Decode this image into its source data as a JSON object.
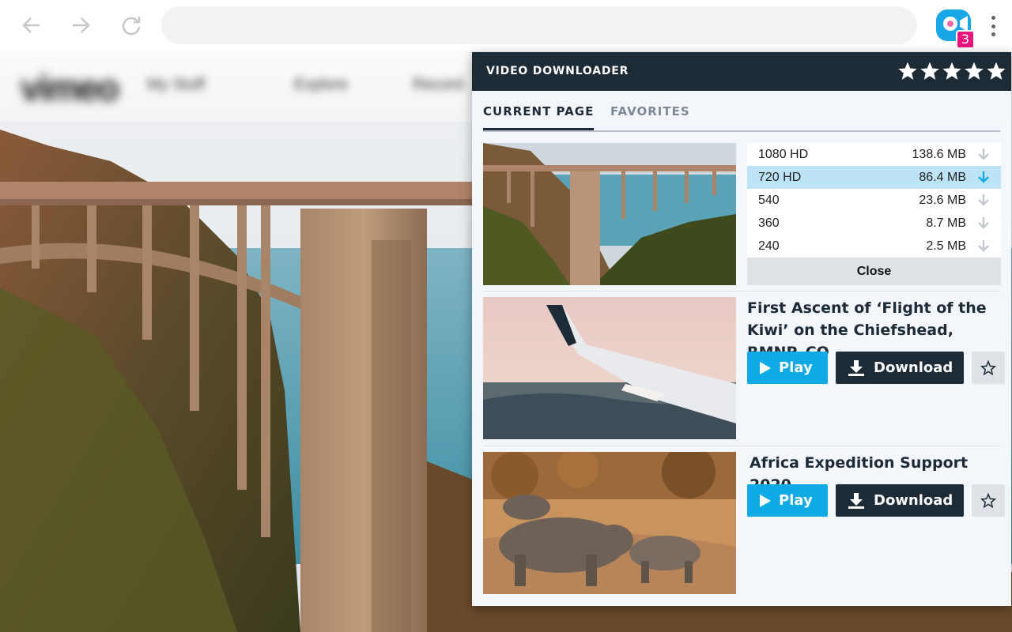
{
  "browser": {
    "back_icon": "arrow-left-icon",
    "forward_icon": "arrow-right-icon",
    "reload_icon": "reload-icon",
    "extension_badge": "3",
    "menu_icon": "more-vert-icon"
  },
  "popup": {
    "title": "VIDEO DOWNLOADER",
    "rating_stars": 5,
    "tabs": [
      {
        "label": "CURRENT PAGE",
        "active": true
      },
      {
        "label": "FAVORITES",
        "active": false
      }
    ],
    "quality_options": [
      {
        "label": "1080 HD",
        "size": "138.6 MB",
        "selected": false
      },
      {
        "label": "720 HD",
        "size": "86.4 MB",
        "selected": true
      },
      {
        "label": "540",
        "size": "23.6 MB",
        "selected": false
      },
      {
        "label": "360",
        "size": "8.7 MB",
        "selected": false
      },
      {
        "label": "240",
        "size": "2.5 MB",
        "selected": false
      }
    ],
    "close_label": "Close",
    "videos": [
      {
        "title": "First Ascent of ‘Flight of the Kiwi’ on the Chiefshead, RMNP, CO",
        "play_label": "Play",
        "download_label": "Download"
      },
      {
        "title": "Africa Expedition Support 2020",
        "play_label": "Play",
        "download_label": "Download"
      }
    ]
  },
  "colors": {
    "header_bg": "#1d2b36",
    "accent_blue": "#0fa9e6",
    "selected_row": "#bde4f6",
    "badge_pink": "#e8177d"
  }
}
